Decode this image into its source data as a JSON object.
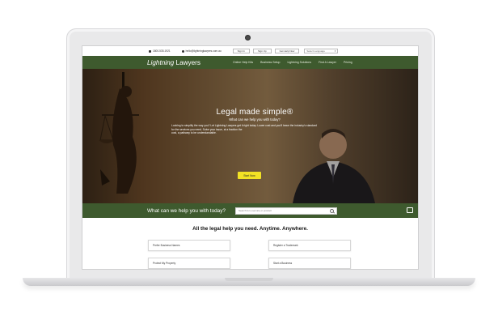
{
  "topbar": {
    "phone": "1800-535-1921",
    "email": "hello@lightninglawyers.com.au",
    "sign_in": "Sign In",
    "sign_up": "Sign Up",
    "get_help": "Get Help Now",
    "language": "Select Language"
  },
  "nav": {
    "logo_italic": "Lightning",
    "logo_rest": " Lawyers",
    "items": [
      "Online Help Kits",
      "Business Setup",
      "Lightning Solutions",
      "Find A Lawyer",
      "Pricing"
    ]
  },
  "hero": {
    "title": "Legal made simple®",
    "subtitle": "What can we help you with today?",
    "body": [
      "Looking to simplify the way you? Let Lightning Lawyers get it right today. Lower cost and you'll leave the industry's standard",
      "for the services you need. Solve your issue, at a fraction the",
      "cost, a pathway to be understandable."
    ],
    "button": "Start Now"
  },
  "search": {
    "label": "What can we help you with today?",
    "placeholder": "Search for a service or product"
  },
  "section": {
    "title": "All the legal help you need. Anytime. Anywhere.",
    "cards": [
      "Prefer Business Names",
      "Register a Trademark",
      "Protect My Property",
      "Start a Business"
    ]
  },
  "colors": {
    "brand_green": "#3e5a2e",
    "cta_yellow": "#f2e225"
  },
  "icons": [
    "phone-icon",
    "mail-icon",
    "search-icon",
    "chat-icon",
    "camera-icon"
  ]
}
